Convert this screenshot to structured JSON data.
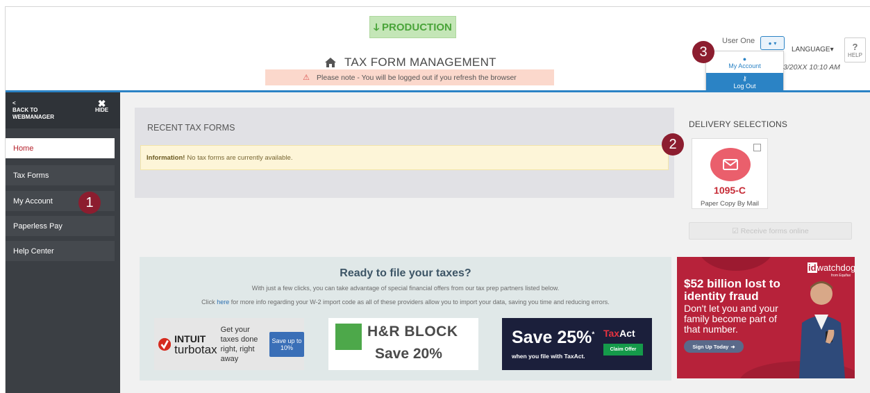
{
  "header": {
    "env_badge": "PRODUCTION",
    "title": "TAX FORM MANAGEMENT",
    "notice": "Please note - You will be logged out if you refresh the browser",
    "user_name": "User One",
    "language": "LANGUAGE",
    "datetime": "3/20XX 10:10 AM",
    "help_label": "HELP",
    "help_symbol": "?"
  },
  "user_menu": {
    "my_account": "My Account",
    "log_out": "Log Out"
  },
  "callouts": [
    "1",
    "2",
    "3"
  ],
  "sidebar": {
    "back_arrow": "<",
    "back_label_1": "BACK TO",
    "back_label_2": "WEBMANAGER",
    "hide_label": "HIDE",
    "items": [
      {
        "label": "Home",
        "active": true
      },
      {
        "label": "Tax Forms"
      },
      {
        "label": "My Account"
      },
      {
        "label": "Paperless Pay"
      },
      {
        "label": "Help Center"
      }
    ]
  },
  "recent": {
    "title": "RECENT TAX FORMS",
    "info_bold": "Information!",
    "info_text": "No tax forms are currently available."
  },
  "delivery": {
    "title": "DELIVERY SELECTIONS",
    "card_code": "1095-C",
    "card_sub": "Paper Copy By Mail",
    "receive_button": "Receive forms online"
  },
  "promo": {
    "title": "Ready to file your taxes?",
    "line1": "With just a few clicks, you can take advantage of special financial offers from our tax prep partners listed below.",
    "line2_pre": "Click",
    "line2_link": "here",
    "line2_post": "for more info regarding your W-2 import code as all of these providers allow you to import your data, saving you time and reducing errors."
  },
  "ads": {
    "turbotax": {
      "intuit": "INTUIT",
      "brand": "turbotax",
      "tagline": "Get your taxes done right, right away",
      "save": "Save up to 10%"
    },
    "hrblock": {
      "name": "H&R BLOCK",
      "save": "Save 20%"
    },
    "taxact": {
      "save": "Save 25%",
      "sup": "*",
      "sub": "when you file with TaxAct.",
      "logo_tax": "Tax",
      "logo_act": "Act",
      "claim": "Claim Offer"
    },
    "idwatchdog": {
      "logo_id": "id",
      "logo_rest": "watchdog",
      "from": "from Equifax",
      "headline": "$52 billion lost to identity fraud",
      "body": "Don't let you and your family become part of that number.",
      "button": "Sign Up Today"
    }
  },
  "colors": {
    "accent_blue": "#2b83c5",
    "sidebar_bg": "#3b3f44",
    "callout": "#8c1d2f",
    "active_nav_text": "#b5212b",
    "mail_icon_bg": "#ea5f6c"
  }
}
